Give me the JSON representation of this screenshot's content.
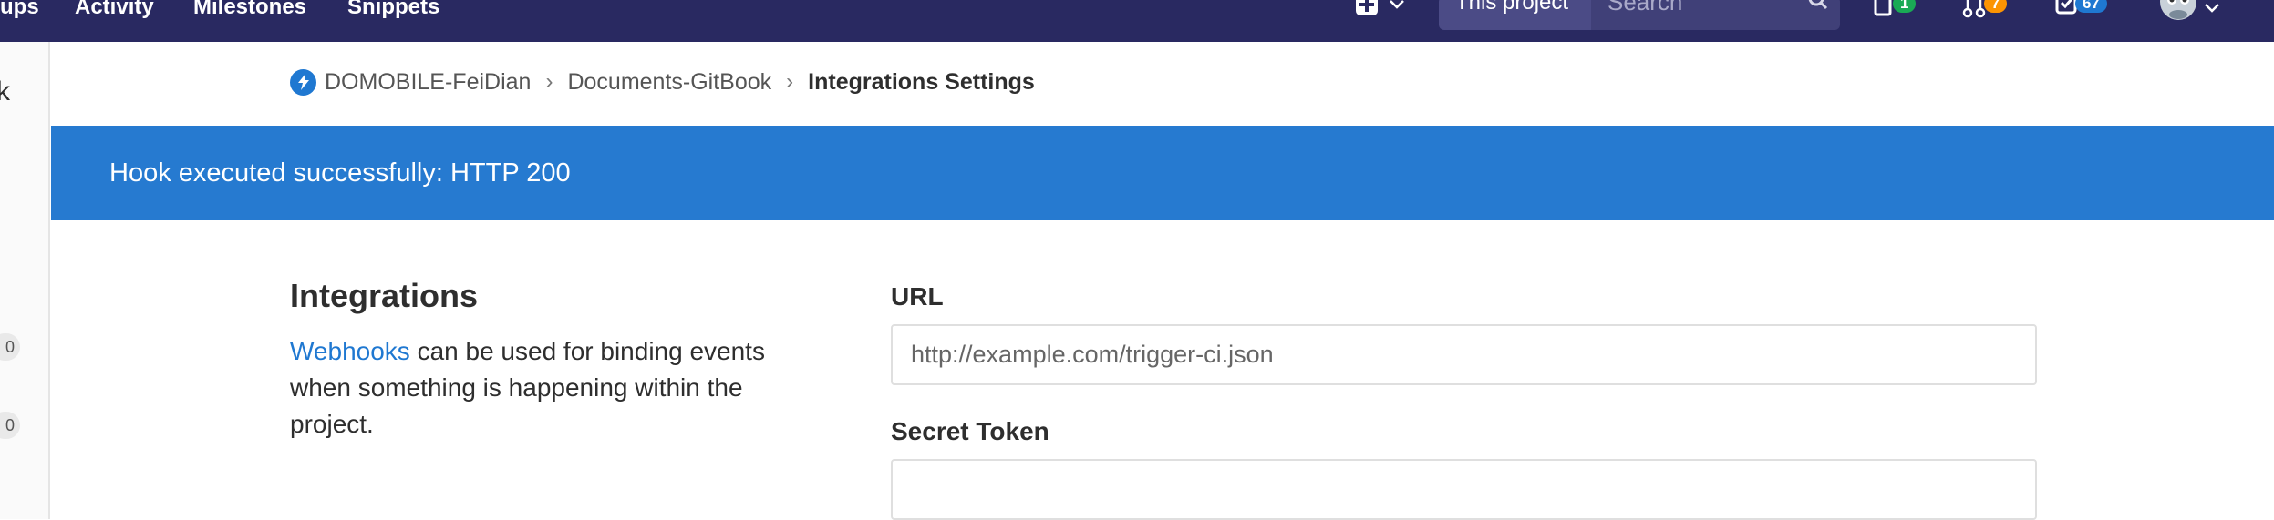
{
  "navbar": {
    "links": [
      "ups",
      "Activity",
      "Milestones",
      "Snippets"
    ],
    "scope_label": "This project",
    "search_placeholder": "Search",
    "issues_count": "1",
    "merge_requests_count": "7",
    "todos_count": "67",
    "colors": {
      "background": "#292961",
      "issues_badge": "#1aaa55",
      "mr_badge": "#fc9403",
      "todos_badge": "#1f78d1"
    }
  },
  "sidebar": {
    "collapse_glyph": "k",
    "pill_1": "0",
    "pill_2": "0"
  },
  "breadcrumb": {
    "group": "DOMOBILE-FeiDian",
    "project": "Documents-GitBook",
    "current": "Integrations Settings"
  },
  "flash": {
    "message": "Hook executed successfully: HTTP 200",
    "color": "#267ad0"
  },
  "integrations": {
    "title": "Integrations",
    "link_text": "Webhooks",
    "description": " can be used for binding events when something is happening within the project."
  },
  "form": {
    "url_label": "URL",
    "url_placeholder": "http://example.com/trigger-ci.json",
    "secret_label": "Secret Token",
    "secret_value": ""
  }
}
